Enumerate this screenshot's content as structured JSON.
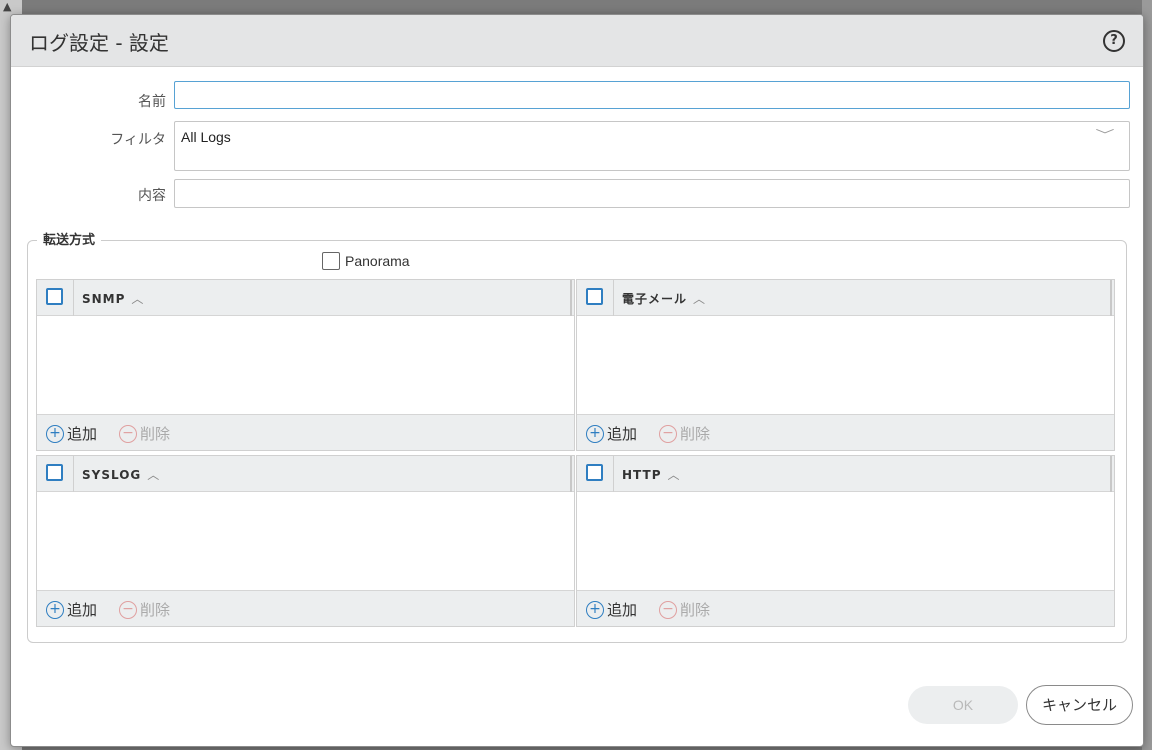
{
  "dialog": {
    "title": "ログ設定 - 設定",
    "help_icon": "help-icon",
    "help_glyph": "?"
  },
  "form": {
    "name_label": "名前",
    "name_value": "",
    "filter_label": "フィルタ",
    "filter_value": "All Logs",
    "description_label": "内容",
    "description_value": ""
  },
  "forwarding": {
    "legend": "転送方式",
    "panorama_label": "Panorama",
    "panorama_checked": false,
    "panels": [
      {
        "column": "SNMP",
        "add_label": "追加",
        "delete_label": "削除"
      },
      {
        "column": "電子メール",
        "add_label": "追加",
        "delete_label": "削除"
      },
      {
        "column": "SYSLOG",
        "add_label": "追加",
        "delete_label": "削除"
      },
      {
        "column": "HTTP",
        "add_label": "追加",
        "delete_label": "削除"
      }
    ]
  },
  "buttons": {
    "ok_label": "OK",
    "cancel_label": "キャンセル"
  },
  "glyphs": {
    "caret_up": "︿",
    "chevron_down": "﹀",
    "plus": "+",
    "minus": "−"
  },
  "colors": {
    "accent_blue": "#2f7ec1",
    "focus_border": "#57a2d4",
    "delete_disabled": "#e0a0a0"
  }
}
